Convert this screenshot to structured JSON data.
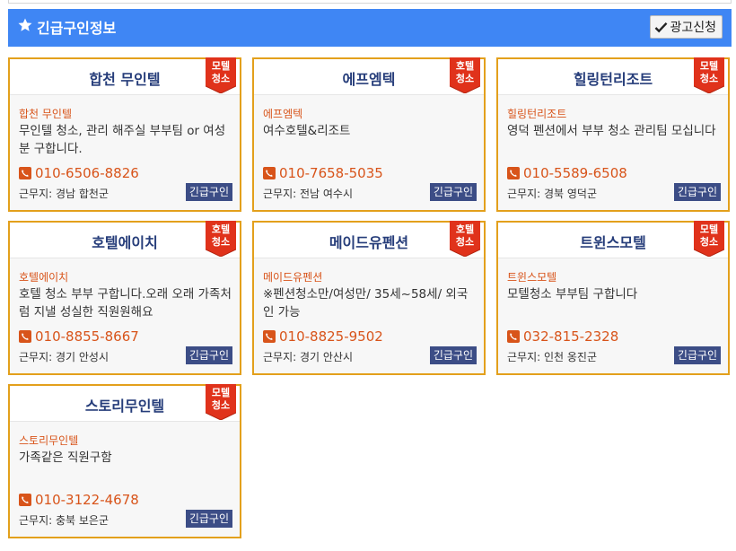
{
  "header": {
    "title": "긴급구인정보",
    "ad_button_label": "광고신청"
  },
  "colors": {
    "header_bg": "#3f86f4",
    "card_border": "#e3a01c",
    "ribbon_red": "#e0321b",
    "accent_orange": "#d8541a",
    "title_navy": "#263d7a",
    "urgent_btn_bg": "#3c4d86"
  },
  "cards": [
    {
      "title": "합천 무인텔",
      "ribbon": "모텔\n청소",
      "company": "합천 무인텔",
      "desc": "무인텔 청소, 관리 해주실 부부팀 or 여성분 구합니다.",
      "phone": "010-6506-8826",
      "location_label": "근무지: ",
      "location": "경남 합천군",
      "button": "긴급구인"
    },
    {
      "title": "에프엠텍",
      "ribbon": "호텔\n청소",
      "company": "에프엠텍",
      "desc": "여수호텔&리조트",
      "phone": "010-7658-5035",
      "location_label": "근무지: ",
      "location": "전남 여수시",
      "button": "긴급구인"
    },
    {
      "title": "힐링턴리조트",
      "ribbon": "모텔\n청소",
      "company": "힐링턴리조트",
      "desc": "영덕 펜션에서 부부 청소 관리팀 모십니다",
      "phone": "010-5589-6508",
      "location_label": "근무지: ",
      "location": "경북 영덕군",
      "button": "긴급구인"
    },
    {
      "title": "호텔에이치",
      "ribbon": "호텔\n청소",
      "company": "호텔에이치",
      "desc": "호텔 청소 부부 구합니다.오래 오래 가족처럼 지낼 성실한 직원원해요",
      "phone": "010-8855-8667",
      "location_label": "근무지: ",
      "location": "경기 안성시",
      "button": "긴급구인"
    },
    {
      "title": "메이드유펜션",
      "ribbon": "호텔\n청소",
      "company": "메이드유펜션",
      "desc": "※펜션청소만/여성만/ 35세~58세/ 외국인 가능",
      "phone": "010-8825-9502",
      "location_label": "근무지: ",
      "location": "경기 안산시",
      "button": "긴급구인"
    },
    {
      "title": "트윈스모텔",
      "ribbon": "모텔\n청소",
      "company": "트윈스모텔",
      "desc": "모텔청소 부부팀 구합니다",
      "phone": "032-815-2328",
      "location_label": "근무지: ",
      "location": "인천 옹진군",
      "button": "긴급구인"
    },
    {
      "title": "스토리무인텔",
      "ribbon": "모텔\n청소",
      "company": "스토리무인텔",
      "desc": "가족같은 직원구함",
      "phone": "010-3122-4678",
      "location_label": "근무지: ",
      "location": "충북 보은군",
      "button": "긴급구인"
    }
  ]
}
